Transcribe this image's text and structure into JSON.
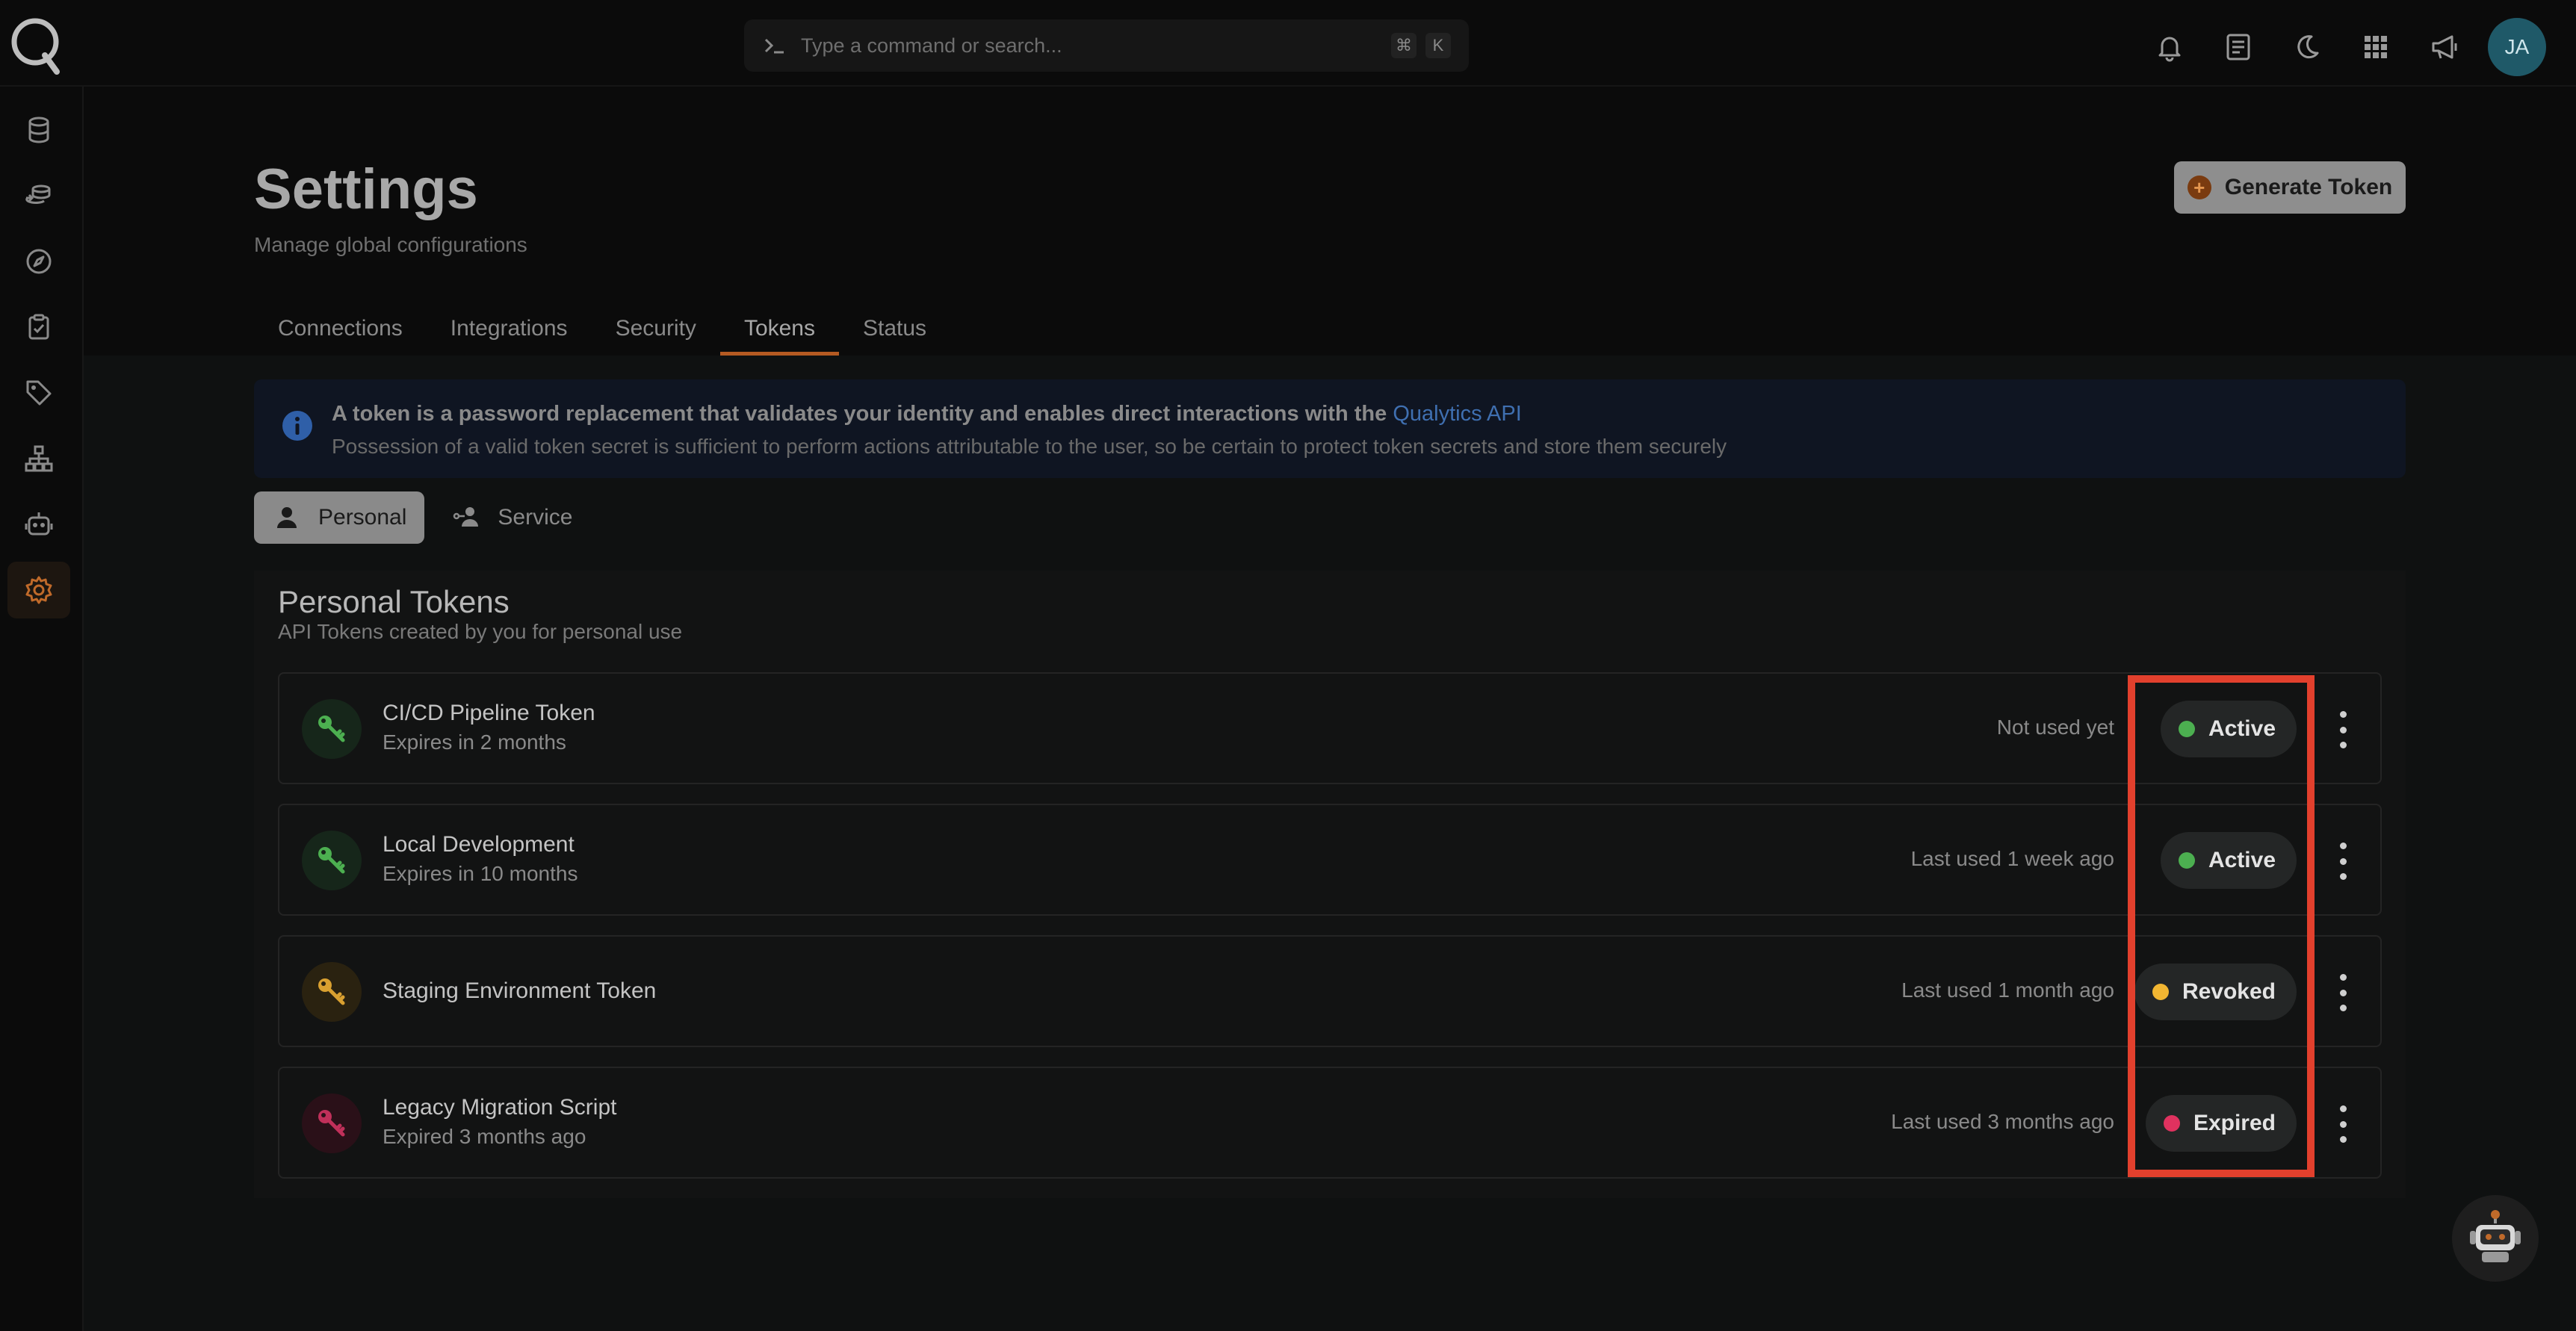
{
  "command_bar": {
    "placeholder": "Type a command or search...",
    "kbd_cmd": "⌘",
    "kbd_k": "K"
  },
  "user": {
    "initials": "JA"
  },
  "page": {
    "title": "Settings",
    "subtitle": "Manage global configurations",
    "generate_button": "Generate Token"
  },
  "tabs": [
    {
      "label": "Connections"
    },
    {
      "label": "Integrations"
    },
    {
      "label": "Security"
    },
    {
      "label": "Tokens"
    },
    {
      "label": "Status"
    }
  ],
  "active_tab": "Tokens",
  "info": {
    "text": "A token is a password replacement that validates your identity and enables direct interactions with the",
    "link": "Qualytics API",
    "note": "Possession of a valid token secret is sufficient to perform actions attributable to the user, so be certain to protect token secrets and store them securely"
  },
  "token_types": [
    {
      "label": "Personal"
    },
    {
      "label": "Service"
    }
  ],
  "panel": {
    "title": "Personal Tokens",
    "subtitle": "API Tokens created by you for personal use"
  },
  "tokens": [
    {
      "name": "CI/CD Pipeline Token",
      "expiry": "Expires in 2 months",
      "last_used": "Not used yet",
      "status": "Active",
      "status_color": "#4caf50"
    },
    {
      "name": "Local Development",
      "expiry": "Expires in 10 months",
      "last_used": "Last used 1 week ago",
      "status": "Active",
      "status_color": "#4caf50"
    },
    {
      "name": "Staging Environment Token",
      "expiry": "",
      "last_used": "Last used 1 month ago",
      "status": "Revoked",
      "status_color": "#f2b632"
    },
    {
      "name": "Legacy Migration Script",
      "expiry": "Expired 3 months ago",
      "last_used": "Last used 3 months ago",
      "status": "Expired",
      "status_color": "#e0325f"
    }
  ],
  "icons": {
    "sidebar": [
      "datastore-icon",
      "layers-icon",
      "compass-icon",
      "checklist-icon",
      "tag-icon",
      "hierarchy-icon",
      "robot-icon",
      "gear-icon"
    ],
    "top": [
      "bell-icon",
      "document-icon",
      "moon-icon",
      "apps-grid-icon",
      "megaphone-icon"
    ]
  }
}
